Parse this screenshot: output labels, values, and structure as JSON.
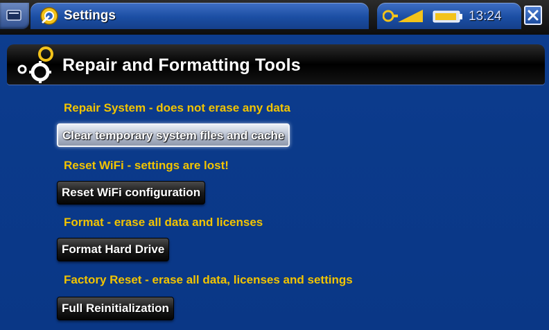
{
  "statusbar": {
    "app_title": "Settings",
    "time": "13:24",
    "icons": [
      "menu-icon",
      "settings-app-icon",
      "signal-icon",
      "battery-icon",
      "close-icon"
    ]
  },
  "header": {
    "title": "Repair and Formatting Tools"
  },
  "sections": [
    {
      "label": "Repair System - does not erase any data",
      "button": "Clear temporary system files and cache",
      "selected": true
    },
    {
      "label": "Reset WiFi - settings are lost!",
      "button": "Reset WiFi configuration",
      "selected": false
    },
    {
      "label": "Format - erase all data and licenses",
      "button": "Format Hard Drive",
      "selected": false
    },
    {
      "label": "Factory Reset - erase all data, licenses and settings",
      "button": "Full Reinitialization",
      "selected": false
    }
  ],
  "colors": {
    "background": "#0b3a8b",
    "label": "#f2c400",
    "button_text": "#ffffff"
  }
}
